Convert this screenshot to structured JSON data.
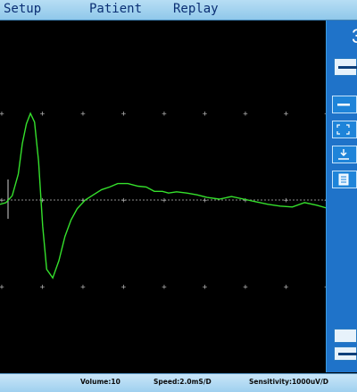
{
  "menu": {
    "setup": "Setup",
    "patient": "Patient",
    "replay": "Replay"
  },
  "side": {
    "top_value": "3"
  },
  "status": {
    "volume": "Volume:10",
    "speed": "Speed:2.0mS/D",
    "sensitivity": "Sensitivity:1000uV/D"
  },
  "colors": {
    "trace": "#35e02c",
    "panel": "#1f73c9",
    "background": "#000000"
  },
  "chart_data": {
    "type": "line",
    "title": "",
    "xlabel": "",
    "ylabel": "",
    "units": {
      "x": "ms",
      "y": "uV"
    },
    "x_per_division": 2.0,
    "y_per_division": 1000,
    "grid": "dotted markers",
    "xlim": [
      0,
      20
    ],
    "ylim": [
      -1000,
      1000
    ],
    "series": [
      {
        "color": "#35e02c",
        "x": [
          0,
          0.3,
          0.6,
          0.9,
          1.1,
          1.3,
          1.5,
          1.7,
          1.9,
          2.1,
          2.3,
          2.6,
          2.9,
          3.2,
          3.5,
          3.8,
          4.2,
          4.6,
          5.0,
          5.4,
          5.8,
          6.3,
          6.8,
          7.2,
          7.6,
          8.0,
          8.3,
          8.7,
          9.2,
          9.7,
          10.2,
          10.8,
          11.4,
          12.0,
          12.6,
          13.2,
          13.8,
          14.4,
          15.0,
          15.6,
          16.2,
          16.8,
          17.4,
          18.0,
          18.6,
          19.2,
          20.0
        ],
        "y": [
          -50,
          -30,
          50,
          300,
          650,
          880,
          1000,
          900,
          450,
          -300,
          -800,
          -900,
          -700,
          -420,
          -230,
          -100,
          0,
          60,
          120,
          150,
          190,
          190,
          160,
          150,
          100,
          100,
          80,
          95,
          80,
          60,
          30,
          10,
          40,
          10,
          -20,
          -50,
          -70,
          -80,
          -30,
          -60,
          -100,
          -80,
          -60,
          -100,
          -80,
          -100,
          -60
        ]
      }
    ]
  }
}
